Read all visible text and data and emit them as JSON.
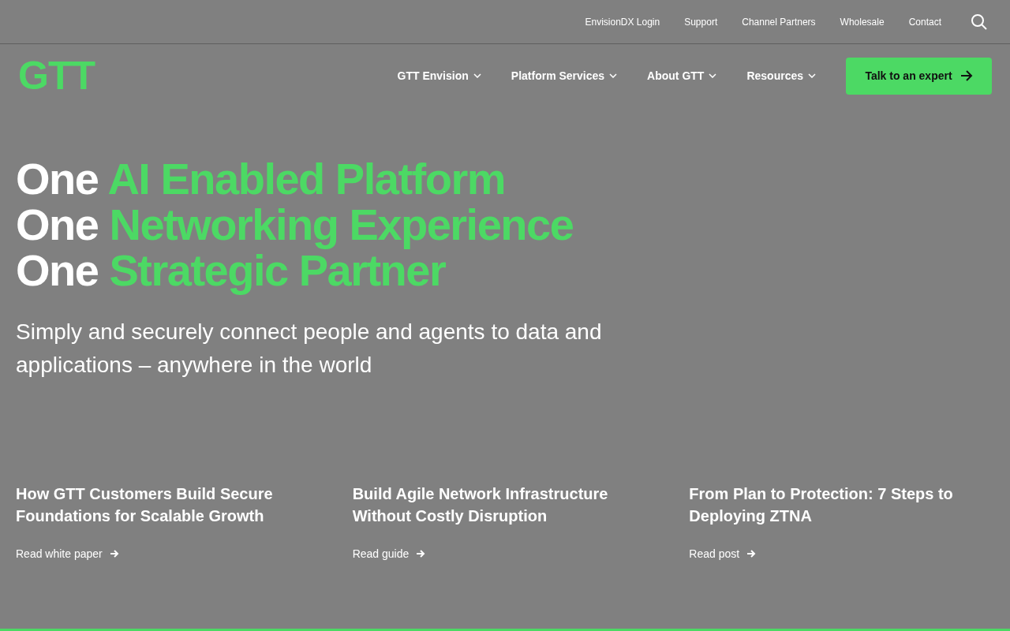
{
  "utility_nav": [
    "EnvisionDX Login",
    "Support",
    "Channel Partners",
    "Wholesale",
    "Contact"
  ],
  "logo": "GTT",
  "main_nav": [
    {
      "label": "GTT Envision"
    },
    {
      "label": "Platform Services"
    },
    {
      "label": "About GTT"
    },
    {
      "label": "Resources"
    }
  ],
  "cta_button": "Talk to an expert",
  "headline": [
    {
      "lead": "One",
      "highlight": "AI Enabled Platform"
    },
    {
      "lead": "One",
      "highlight": "Networking Experience"
    },
    {
      "lead": "One",
      "highlight": "Strategic Partner"
    }
  ],
  "subheadline": "Simply and securely connect people and agents to data and applications – anywhere in the world",
  "cards": [
    {
      "title": "How GTT Customers Build Secure Foundations for Scalable Growth",
      "link": "Read white paper"
    },
    {
      "title": "Build Agile Network Infrastructure Without Costly Disruption",
      "link": "Read guide"
    },
    {
      "title": "From Plan to Protection: 7 Steps to Deploying ZTNA",
      "link": "Read post"
    }
  ]
}
